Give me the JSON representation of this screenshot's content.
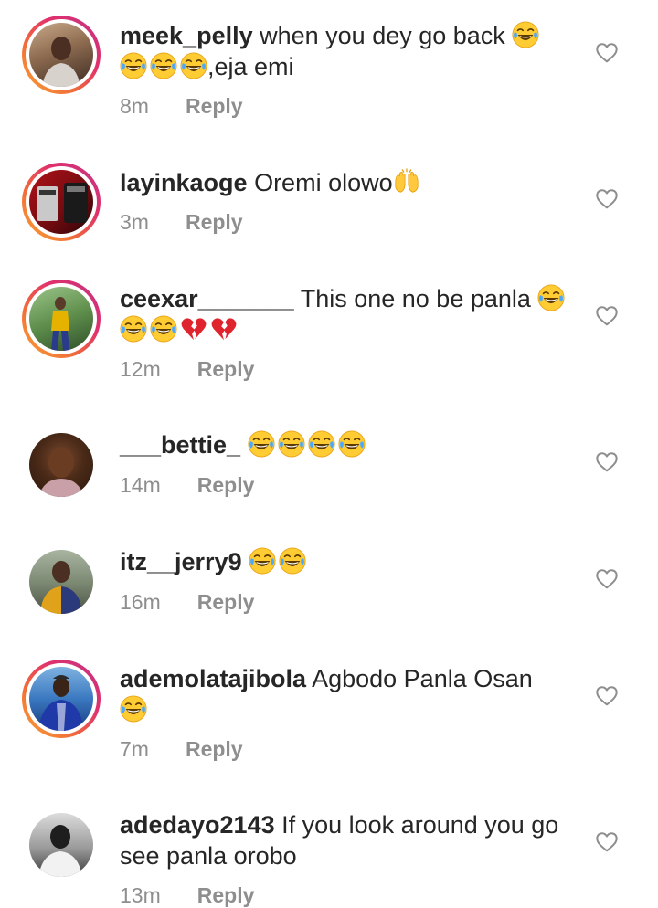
{
  "reply_label": "Reply",
  "colors": {
    "text": "#262626",
    "muted": "#8e8e8e",
    "ring_start": "#f9a634",
    "ring_end": "#c13584"
  },
  "comments": [
    {
      "username": "meek_pelly",
      "text_before": " when you dey go back ",
      "text_after": ",eja emi",
      "time": "8m",
      "has_story_ring": true,
      "emoji": [
        "joy",
        "joy",
        "joy",
        "joy"
      ]
    },
    {
      "username": "layinkaoge",
      "text_before": " Oremi olowo",
      "text_after": "",
      "time": "3m",
      "has_story_ring": true,
      "emoji": [
        "raising-hands"
      ]
    },
    {
      "username": "ceexar_______",
      "text_before": " This one no be panla ",
      "text_after": "",
      "time": "12m",
      "has_story_ring": true,
      "emoji": [
        "joy",
        "joy",
        "joy",
        "broken-heart",
        "broken-heart"
      ]
    },
    {
      "username": "___bettie_",
      "text_before": " ",
      "text_after": "",
      "time": "14m",
      "has_story_ring": false,
      "emoji": [
        "joy",
        "joy",
        "joy",
        "joy"
      ]
    },
    {
      "username": "itz__jerry9",
      "text_before": " ",
      "text_after": "",
      "time": "16m",
      "has_story_ring": false,
      "emoji": [
        "joy",
        "joy"
      ]
    },
    {
      "username": "ademolatajibola",
      "text_before": " Agbodo Panla Osan",
      "text_after": "",
      "time": "7m",
      "has_story_ring": true,
      "emoji": [
        "joy"
      ]
    },
    {
      "username": "adedayo2143",
      "text_before": " If you look around you go see panla orobo",
      "text_after": "",
      "time": "13m",
      "has_story_ring": false,
      "emoji": []
    }
  ]
}
